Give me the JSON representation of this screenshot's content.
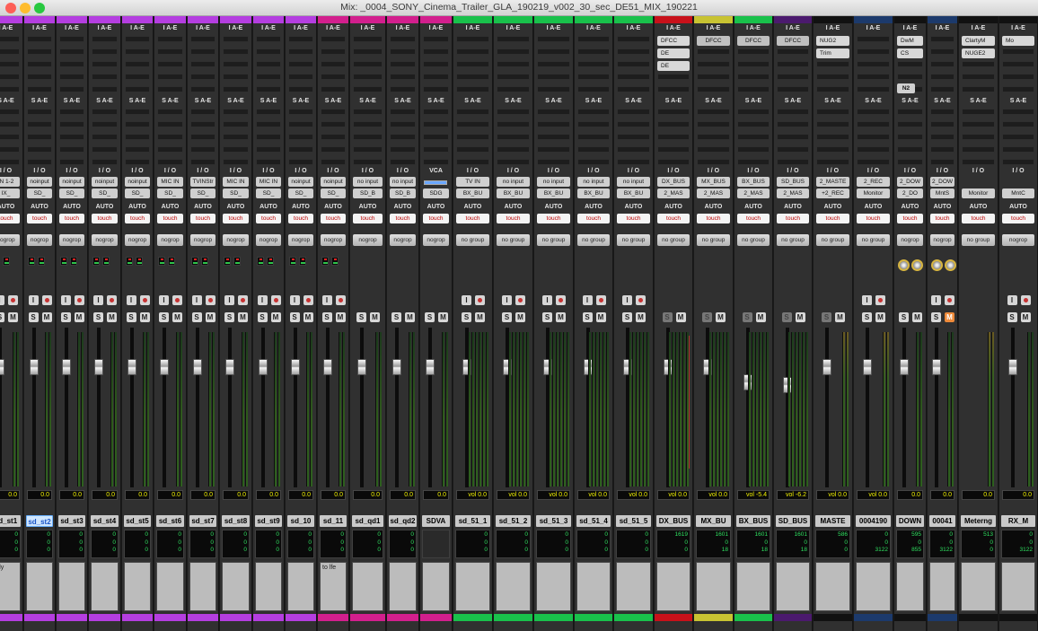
{
  "window": {
    "title": "Mix: _0004_SONY_Cinema_Trailer_GLA_190219_v002_30_sec_DE51_MIX_190221"
  },
  "labels": {
    "ins_header": "I A-E",
    "send_header": "S A-E",
    "io_header": "I / O",
    "vca_header": "VCA",
    "auto_header": "AUTO",
    "n2": "N2"
  },
  "colors": {
    "purple": "#b43ee0",
    "magenta": "#d21f8d",
    "green": "#19c14b",
    "red": "#c8111a",
    "yellow": "#c8c332",
    "dkpurple": "#4b1a6e",
    "black": "#111111",
    "navy": "#1c3a6c",
    "accent_blue": "#1a55c8"
  },
  "tracks": [
    {
      "name": "sd_st1",
      "in": "IN 1-2",
      "out": "IX_",
      "auto": "touch",
      "group": "nogrop",
      "vol": "0.0",
      "cnt": [
        "0",
        "0",
        "0"
      ],
      "cmt": "ndy",
      "bar": "purple"
    },
    {
      "name": "sd_st2",
      "in": "noinput",
      "out": "SD_",
      "auto": "touch",
      "group": "nogrop",
      "vol": "0.0",
      "cnt": [
        "0",
        "0",
        "0"
      ],
      "cmt": "",
      "bar": "purple",
      "sel": true
    },
    {
      "name": "sd_st3",
      "in": "noinput",
      "out": "SD_",
      "auto": "touch",
      "group": "nogrop",
      "vol": "0.0",
      "cnt": [
        "0",
        "0",
        "0"
      ],
      "cmt": "",
      "bar": "purple"
    },
    {
      "name": "sd_st4",
      "in": "noinput",
      "out": "SD_",
      "auto": "touch",
      "group": "nogrop",
      "vol": "0.0",
      "cnt": [
        "0",
        "0",
        "0"
      ],
      "cmt": "",
      "bar": "purple"
    },
    {
      "name": "sd_st5",
      "in": "noinput",
      "out": "SD_",
      "auto": "touch",
      "group": "nogrop",
      "vol": "0.0",
      "cnt": [
        "0",
        "0",
        "0"
      ],
      "cmt": "",
      "bar": "purple"
    },
    {
      "name": "sd_st6",
      "in": "MIC IN",
      "out": "SD_",
      "auto": "touch",
      "group": "nogrop",
      "vol": "0.0",
      "cnt": [
        "0",
        "0",
        "0"
      ],
      "cmt": "",
      "bar": "purple"
    },
    {
      "name": "sd_st7",
      "in": "TVINStr",
      "out": "SD_",
      "auto": "touch",
      "group": "nogrop",
      "vol": "0.0",
      "cnt": [
        "0",
        "0",
        "0"
      ],
      "cmt": "",
      "bar": "purple"
    },
    {
      "name": "sd_st8",
      "in": "MIC IN",
      "out": "SD_",
      "auto": "touch",
      "group": "nogrop",
      "vol": "0.0",
      "cnt": [
        "0",
        "0",
        "0"
      ],
      "cmt": "",
      "bar": "purple"
    },
    {
      "name": "sd_st9",
      "in": "MIC IN",
      "out": "SD_",
      "auto": "touch",
      "group": "nogrop",
      "vol": "0.0",
      "cnt": [
        "0",
        "0",
        "0"
      ],
      "cmt": "",
      "bar": "purple"
    },
    {
      "name": "sd_10",
      "in": "noinput",
      "out": "SD_",
      "auto": "touch",
      "group": "nogrop",
      "vol": "0.0",
      "cnt": [
        "0",
        "0",
        "0"
      ],
      "cmt": "",
      "bar": "purple"
    },
    {
      "name": "sd_11",
      "in": "noinput",
      "out": "SD_",
      "auto": "touch",
      "group": "nogrop",
      "vol": "0.0",
      "cnt": [
        "0",
        "0",
        "0"
      ],
      "cmt": "to lfe",
      "bar": "magenta"
    },
    {
      "name": "sd_qd1",
      "in": "no input",
      "out": "SD_B",
      "auto": "touch",
      "group": "nogrop",
      "vol": "0.0",
      "cnt": [
        "0",
        "0",
        "0"
      ],
      "cmt": "",
      "bar": "magenta"
    },
    {
      "name": "sd_qd2",
      "in": "no input",
      "out": "SD_B",
      "auto": "touch",
      "group": "nogrop",
      "vol": "0.0",
      "cnt": [
        "0",
        "0",
        "0"
      ],
      "cmt": "",
      "bar": "magenta"
    },
    {
      "name": "SDVA",
      "in": "",
      "out": "SDG",
      "auto": "touch",
      "group": "nogrop",
      "vol": "0.0",
      "cnt": [
        "",
        "",
        ""
      ],
      "cmt": "",
      "bar": "magenta"
    },
    {
      "name": "sd_51_1",
      "in": "TV IN",
      "out": "BX_BU",
      "auto": "touch",
      "group": "no group",
      "vol": "vol   0.0",
      "cnt": [
        "0",
        "0",
        "0"
      ],
      "cmt": "",
      "bar": "green"
    },
    {
      "name": "sd_51_2",
      "in": "no input",
      "out": "BX_BU",
      "auto": "touch",
      "group": "no group",
      "vol": "vol   0.0",
      "cnt": [
        "0",
        "0",
        "0"
      ],
      "cmt": "",
      "bar": "green"
    },
    {
      "name": "sd_51_3",
      "in": "no input",
      "out": "BX_BU",
      "auto": "touch",
      "group": "no group",
      "vol": "vol   0.0",
      "cnt": [
        "0",
        "0",
        "0"
      ],
      "cmt": "",
      "bar": "green"
    },
    {
      "name": "sd_51_4",
      "in": "no input",
      "out": "BX_BU",
      "auto": "touch",
      "group": "no group",
      "vol": "vol   0.0",
      "cnt": [
        "0",
        "0",
        "0"
      ],
      "cmt": "",
      "bar": "green"
    },
    {
      "name": "sd_51_5",
      "in": "no input",
      "out": "BX_BU",
      "auto": "touch",
      "group": "no group",
      "vol": "vol   0.0",
      "cnt": [
        "0",
        "0",
        "0"
      ],
      "cmt": "",
      "bar": "green"
    },
    {
      "name": "DX_BUS",
      "in": "DX_BUS",
      "out": "2_MAS",
      "auto": "touch",
      "group": "no group",
      "vol": "vol   0.0",
      "cnt": [
        "1619",
        "0",
        "0"
      ],
      "cmt": "",
      "bar": "red",
      "inserts": [
        "DFCC",
        "DE",
        "DE"
      ]
    },
    {
      "name": "MX_BU",
      "in": "MX_BUS",
      "out": "2_MAS",
      "auto": "touch",
      "group": "no group",
      "vol": "vol   0.0",
      "cnt": [
        "1601",
        "0",
        "18"
      ],
      "cmt": "",
      "bar": "yellow",
      "inserts": [
        "DFCC"
      ]
    },
    {
      "name": "BX_BUS",
      "in": "BX_BUS",
      "out": "2_MAS",
      "auto": "touch",
      "group": "no group",
      "vol": "vol  -5.4",
      "cnt": [
        "1601",
        "0",
        "18"
      ],
      "cmt": "",
      "bar": "green",
      "inserts": [
        "DFCC"
      ]
    },
    {
      "name": "SD_BUS",
      "in": "SD_BUS",
      "out": "2_MAS",
      "auto": "touch",
      "group": "no group",
      "vol": "vol  -6.2",
      "cnt": [
        "1601",
        "0",
        "18"
      ],
      "cmt": "",
      "bar": "dkpurple",
      "inserts": [
        "DFCC"
      ]
    },
    {
      "name": "MASTE",
      "in": "2_MASTE",
      "out": "+2_REC",
      "auto": "touch",
      "group": "no group",
      "vol": "vol   0.0",
      "cnt": [
        "586",
        "0",
        "0"
      ],
      "cmt": "",
      "bar": "black",
      "inserts": [
        "NUG2",
        "Trim"
      ]
    },
    {
      "name": "0004190",
      "in": "2_REC",
      "out": "Monitor",
      "auto": "touch",
      "group": "no group",
      "vol": "vol   0.0",
      "cnt": [
        "0",
        "0",
        "3122"
      ],
      "cmt": "",
      "bar": "navy"
    },
    {
      "name": "DOWN",
      "in": "2_DOW",
      "out": "2_DO",
      "auto": "touch",
      "group": "nogrop",
      "vol": "0.0",
      "cnt": [
        "595",
        "0",
        "855"
      ],
      "cmt": "",
      "bar": "black",
      "inserts": [
        "DwM",
        "CS"
      ]
    },
    {
      "name": "00041",
      "in": "2_DOW",
      "out": "MntS",
      "auto": "touch",
      "group": "nogrop",
      "vol": "0.0",
      "cnt": [
        "0",
        "0",
        "3122"
      ],
      "cmt": "",
      "bar": "navy"
    },
    {
      "name": "Meterng",
      "in": "",
      "out": "Monitor",
      "auto": "touch",
      "group": "no group",
      "vol": "0.0",
      "cnt": [
        "513",
        "0",
        "0"
      ],
      "cmt": "",
      "bar": "black",
      "inserts": [
        "ClartyM",
        "NUGE2"
      ]
    },
    {
      "name": "RX_M",
      "in": "",
      "out": "MntC",
      "auto": "touch",
      "group": "nogrop",
      "vol": "0.0",
      "cnt": [
        "0",
        "0",
        "3122"
      ],
      "cmt": "",
      "bar": "black",
      "inserts": [
        "Mo"
      ]
    }
  ]
}
